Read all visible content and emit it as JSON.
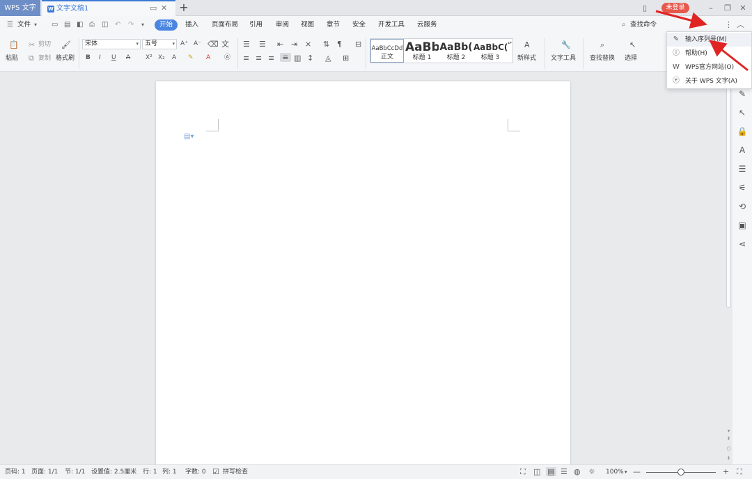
{
  "titlebar": {
    "app_tab": "WPS 文字",
    "doc_tab": "文字文稿1",
    "doc_icon": "W",
    "new_tab": "+",
    "login": "未登录",
    "icons": [
      "display-icon",
      "close-icon",
      "tablet-icon",
      "minimize-icon",
      "restore-icon",
      "window-close-icon"
    ]
  },
  "menubar": {
    "file": "文件",
    "items": [
      "开始",
      "插入",
      "页面布局",
      "引用",
      "审阅",
      "视图",
      "章节",
      "安全",
      "开发工具",
      "云服务"
    ],
    "active": "开始",
    "search": "查找命令"
  },
  "ribbon": {
    "paste": "粘贴",
    "cut": "剪切",
    "copy": "复制",
    "format_painter": "格式刷",
    "font_name": "宋体",
    "font_size": "五号",
    "styles": [
      {
        "preview": "AaBbCcDd",
        "label": "正文"
      },
      {
        "preview": "AaBb",
        "label": "标题 1"
      },
      {
        "preview": "AaBb(",
        "label": "标题 2"
      },
      {
        "preview": "AaBbC(",
        "label": "标题 3"
      }
    ],
    "new_style": "新样式",
    "text_tools": "文字工具",
    "find_replace": "查找替换",
    "select": "选择"
  },
  "dropdown": {
    "items": [
      {
        "icon": "pencil-icon",
        "label": "输入序列号(M)"
      },
      {
        "icon": "help-icon",
        "label": "帮助(H)"
      },
      {
        "icon": "wps-logo-icon",
        "label": "WPS官方网站(O)"
      },
      {
        "icon": "info-icon",
        "label": "关于 WPS 文字(A)"
      }
    ]
  },
  "statusbar": {
    "page_num": "页码: 1",
    "pages": "页面: 1/1",
    "section": "节: 1/1",
    "setting": "设置值: 2.5厘米",
    "row": "行: 1",
    "col": "列: 1",
    "words": "字数: 0",
    "spellcheck": "拼写检查",
    "zoom": "100%",
    "zoom_fraction": 0.5
  },
  "colors": {
    "accent": "#4b85e2",
    "login": "#e6584c",
    "arrow": "#e02424"
  }
}
